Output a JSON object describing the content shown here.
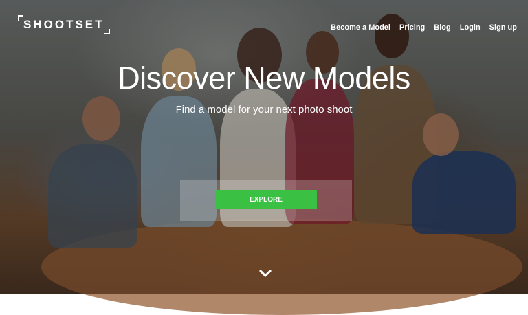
{
  "brand": {
    "logo_text": "SHOOTSET"
  },
  "nav": {
    "items": [
      {
        "label": "Become a Model"
      },
      {
        "label": "Pricing"
      },
      {
        "label": "Blog"
      },
      {
        "label": "Login"
      },
      {
        "label": "Sign up"
      }
    ]
  },
  "hero": {
    "title": "Discover New Models",
    "subtitle": "Find a model for your next photo shoot",
    "cta_label": "EXPLORE",
    "cta_color": "#3ac143",
    "scroll_icon": "chevron-down-icon"
  }
}
